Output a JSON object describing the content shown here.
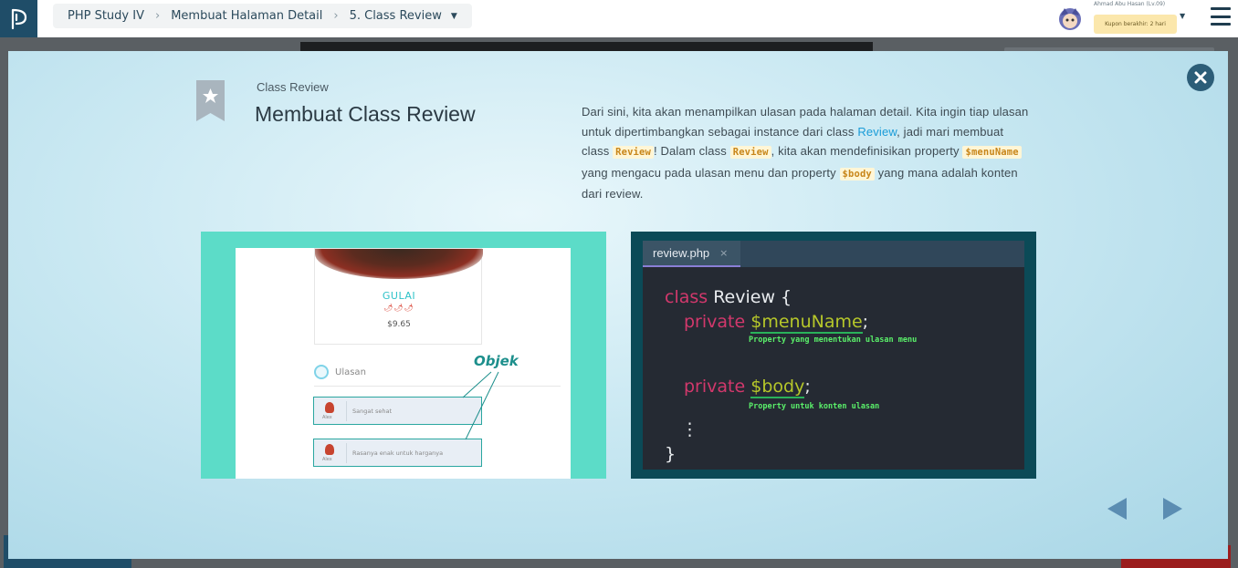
{
  "header": {
    "breadcrumb": [
      "PHP Study IV",
      "Membuat Halaman Detail",
      "5. Class Review"
    ],
    "username": "Ahmad Abu Hasan (Lv.09)",
    "coupon": "Kupon berakhir: 2 hari"
  },
  "slide": {
    "kicker": "Class Review",
    "title": "Membuat Class Review",
    "desc": {
      "p1": "Dari sini, kita akan menampilkan ulasan pada halaman detail. Kita ingin tiap ulasan untuk dipertimbangkan sebagai instance dari class ",
      "link": "Review",
      "p2": ", jadi mari membuat class ",
      "code1": "Review",
      "p3": "! Dalam class ",
      "code2": "Review",
      "p4": ", kita akan mendefinisikan property ",
      "code3": "$menuName",
      "p5": " yang mengacu pada ulasan menu dan property ",
      "code4": "$body",
      "p6": " yang mana adalah konten dari review."
    }
  },
  "left_image": {
    "dish_name": "GULAI",
    "chili": "🌶🌶🌶",
    "price": "$9.65",
    "reviews_label": "Ulasan",
    "objek_label": "Objek",
    "reviews": [
      {
        "name": "Alex",
        "text": "Sangat sehat"
      },
      {
        "name": "Alex",
        "text": "Rasanya enak untuk harganya"
      }
    ]
  },
  "code_image": {
    "tab_name": "review.php",
    "tab_close": "×",
    "line1_kw": "class",
    "line1_rest": " Review {",
    "line2_kw": "private",
    "line2_var": "$menuName",
    "line2_end": ";",
    "note1": "Property yang menentukan ulasan menu",
    "line3_kw": "private",
    "line3_var": "$body",
    "line3_end": ";",
    "note2": "Property untuk konten ulasan",
    "ellipsis": "⋮",
    "close_brace": "}"
  },
  "colors": {
    "modal_accent": "#2c5d78",
    "link": "#1a9cd8",
    "code_bg": "#252a33",
    "left_bg": "#5cdcc8"
  },
  "icons": [
    "logo-icon",
    "close-icon",
    "bookmark-star-icon",
    "menu-icon",
    "prev-arrow-icon",
    "next-arrow-icon"
  ]
}
